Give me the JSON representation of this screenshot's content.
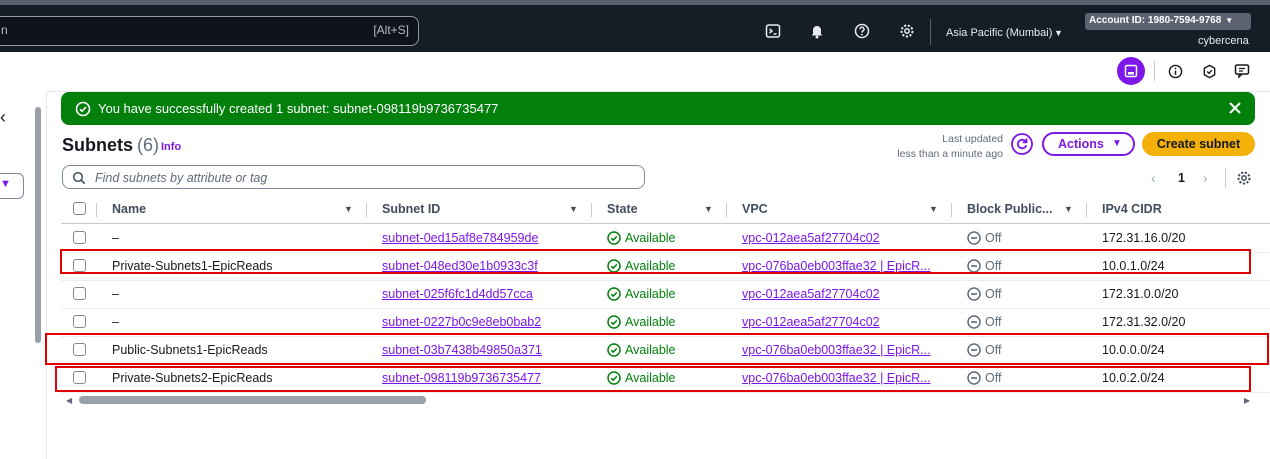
{
  "topnav": {
    "search_placeholder": "n",
    "search_shortcut": "[Alt+S]",
    "region": "Asia Pacific (Mumbai)",
    "account_label": "Account ID: 1980-7594-9768",
    "username": "cybercena",
    "icons": [
      "cloudshell-icon",
      "bell-icon",
      "help-icon",
      "gear-icon"
    ]
  },
  "flash": {
    "message": "You have successfully created 1 subnet: subnet-098119b9736735477",
    "color": "#037f0c"
  },
  "header": {
    "title": "Subnets",
    "count": "(6)",
    "info": "Info",
    "last_updated_label": "Last updated",
    "last_updated_value": "less than a minute ago",
    "actions_label": "Actions",
    "create_label": "Create subnet"
  },
  "filter": {
    "placeholder": "Find subnets by attribute or tag"
  },
  "pagination": {
    "current_page": "1"
  },
  "table": {
    "columns": [
      "Name",
      "Subnet ID",
      "State",
      "VPC",
      "Block Public...",
      "IPv4 CIDR"
    ],
    "rows": [
      {
        "name": "–",
        "subnet_id": "subnet-0ed15af8e784959de",
        "state": "Available",
        "vpc": "vpc-012aea5af27704c02",
        "block_public": "Off",
        "cidr": "172.31.16.0/20",
        "highlighted": false
      },
      {
        "name": "Private-Subnets1-EpicReads",
        "subnet_id": "subnet-048ed30e1b0933c3f",
        "state": "Available",
        "vpc": "vpc-076ba0eb003ffae32 | EpicR...",
        "block_public": "Off",
        "cidr": "10.0.1.0/24",
        "highlighted": true
      },
      {
        "name": "–",
        "subnet_id": "subnet-025f6fc1d4dd57cca",
        "state": "Available",
        "vpc": "vpc-012aea5af27704c02",
        "block_public": "Off",
        "cidr": "172.31.0.0/20",
        "highlighted": false
      },
      {
        "name": "–",
        "subnet_id": "subnet-0227b0c9e8eb0bab2",
        "state": "Available",
        "vpc": "vpc-012aea5af27704c02",
        "block_public": "Off",
        "cidr": "172.31.32.0/20",
        "highlighted": false
      },
      {
        "name": "Public-Subnets1-EpicReads",
        "subnet_id": "subnet-03b7438b49850a371",
        "state": "Available",
        "vpc": "vpc-076ba0eb003ffae32 | EpicR...",
        "block_public": "Off",
        "cidr": "10.0.0.0/24",
        "highlighted": true
      },
      {
        "name": "Private-Subnets2-EpicReads",
        "subnet_id": "subnet-098119b9736735477",
        "state": "Available",
        "vpc": "vpc-076ba0eb003ffae32 | EpicR...",
        "block_public": "Off",
        "cidr": "10.0.2.0/24",
        "highlighted": true
      }
    ]
  },
  "colors": {
    "accent": "#7d16e8",
    "success": "#037f0c",
    "primary_button": "#f3b10a",
    "highlight_box": "#e00000",
    "nav_bg": "#161d26"
  }
}
